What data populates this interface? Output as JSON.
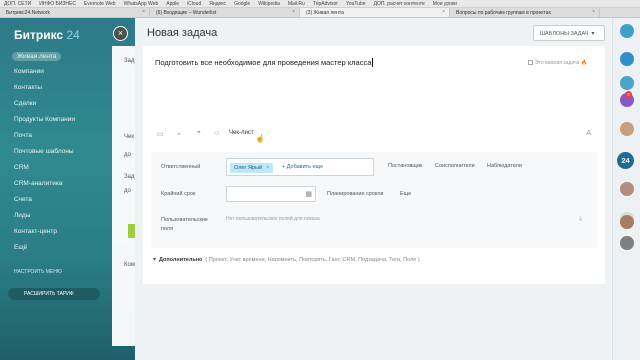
{
  "browser": {
    "bookmarks": [
      "ДОП. СЕТИ",
      "ИНФО БИЗНЕС",
      "Evernote Web",
      "WhatsApp Web",
      "Apple",
      "iCloud",
      "Яндекс",
      "Google",
      "Wikipedia",
      "Mail.Ru",
      "TripAdvisor",
      "YouTube",
      "ДОП. расчет контенте",
      "Мои уроки"
    ],
    "tabs": [
      {
        "label": "Битрикс24.Network"
      },
      {
        "label": "(6) Входящие – Wunderlist"
      },
      {
        "label": "(3) Живая лента"
      },
      {
        "label": "Вопросы по рабочим группам в проектах"
      }
    ]
  },
  "app": {
    "logo": "Битрикс",
    "logo_num": "24",
    "sidebar": {
      "items": [
        "Живая лента",
        "Компании",
        "Контакты",
        "Сделки",
        "Продукты Компании",
        "Почта",
        "Почтовые шаблоны",
        "CRM",
        "CRM-аналитика",
        "Счета",
        "Лиды",
        "Контакт-центр",
        "Ещё"
      ],
      "small": "НАСТРОИТЬ МЕНЮ",
      "expand": "РАСШИРИТЬ ТАРИФ"
    },
    "bg_texts": [
      "Зад",
      "Чек",
      "до",
      "Зад",
      "до",
      "Ком"
    ]
  },
  "rail": {
    "badge_count": "3",
    "counter": "24",
    "avatar_badge": "1"
  },
  "slider": {
    "title": "Новая задача",
    "templates_button": "ШАБЛОНЫ ЗАДАЧ",
    "task_title": "Подготовить все необходимое для проведения мастер класса",
    "important_label": "Это важная задача",
    "toolbar": {
      "checklist_label": "Чек-лист",
      "icons": [
        "editor-icon",
        "attach-icon",
        "quote-icon",
        "mention-icon"
      ],
      "format": "A"
    },
    "fields": {
      "responsible_label": "Ответственный",
      "responsible_user": "Олег Ярый",
      "add_more": "+ Добавить еще",
      "role_links": [
        "Постановщик",
        "Соисполнители",
        "Наблюдатели"
      ],
      "deadline_label": "Крайний срок",
      "deadline_value": "",
      "plan_link": "Планирование сроков",
      "more_link": "Еще",
      "custom_label": "Пользовательские поля",
      "custom_empty": "Нет пользовательских полей для показа"
    },
    "additional": {
      "label": "Дополнительно",
      "items": "( Проект, Учет времени, Напомнить, Повторять, Гант, CRM, Подзадача, Теги, Поле )"
    }
  }
}
